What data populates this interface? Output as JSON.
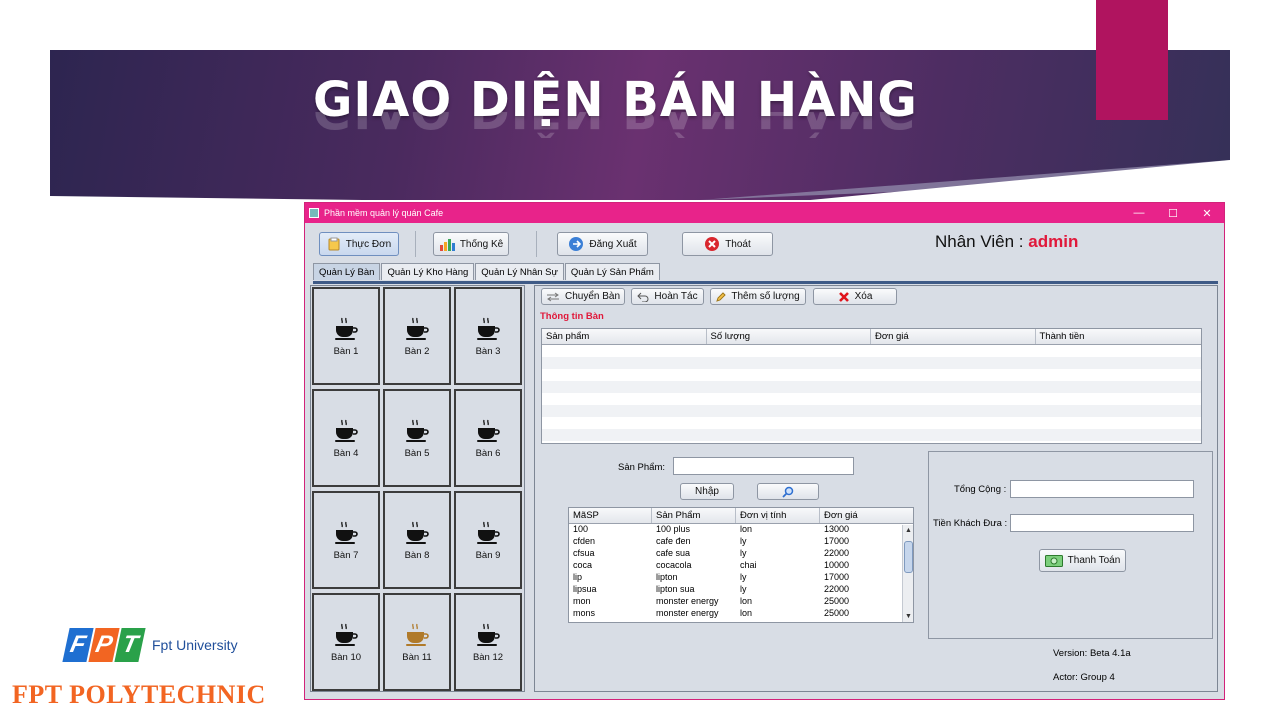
{
  "slide": {
    "title": "GIAO DIỆN BÁN HÀNG",
    "colors": {
      "banner": "#4a2a5e",
      "accent": "#b0145f",
      "poly": "#f26522"
    },
    "logo": {
      "letters": [
        "F",
        "P",
        "T"
      ],
      "letter_colors": [
        "#1f6fd1",
        "#f26522",
        "#2aa14a"
      ],
      "tagline": "Fpt University",
      "brand": "FPT POLYTECHNIC"
    }
  },
  "window": {
    "title": "Phần mềm quản lý quán Cafe",
    "controls": [
      "—",
      "☐",
      "✕"
    ],
    "toolbar": {
      "menu": "Thực Đơn",
      "stats": "Thống Kê",
      "logout": "Đăng Xuất",
      "exit": "Thoát"
    },
    "employee": {
      "label": "Nhân Viên : ",
      "name": "admin"
    },
    "tabs": [
      "Quản Lý Bàn",
      "Quản Lý Kho Hàng",
      "Quản Lý Nhân Sự",
      "Quản Lý Sản Phẩm"
    ],
    "tables": [
      "Bàn 1",
      "Bàn 2",
      "Bàn 3",
      "Bàn 4",
      "Bàn 5",
      "Bàn 6",
      "Bàn 7",
      "Bàn 8",
      "Bàn 9",
      "Bàn 10",
      "Bàn 11",
      "Bàn 12"
    ],
    "table_icon": "coffee-cup-icon",
    "occupied_table": "Bàn 11",
    "actions": {
      "move": "Chuyển Bàn",
      "undo": "Hoàn Tác",
      "add_qty": "Thêm số lượng",
      "delete": "Xóa"
    },
    "info_title": "Thông tin Bàn",
    "order_columns": [
      "Sản phẩm",
      "Số lượng",
      "Đơn giá",
      "Thành tiền"
    ],
    "search": {
      "label": "Sản Phẩm:",
      "value": "",
      "enter": "Nhập"
    },
    "product_columns": [
      "MãSP",
      "Sản Phẩm",
      "Đơn vị tính",
      "Đơn giá"
    ],
    "products": [
      [
        "100",
        "100 plus",
        "lon",
        "13000"
      ],
      [
        "cfden",
        "cafe đen",
        "ly",
        "17000"
      ],
      [
        "cfsua",
        "cafe sua",
        "ly",
        "22000"
      ],
      [
        "coca",
        "cocacola",
        "chai",
        "10000"
      ],
      [
        "lip",
        "lipton",
        "ly",
        "17000"
      ],
      [
        "lipsua",
        "lipton sua",
        "ly",
        "22000"
      ],
      [
        "mon",
        "monster energy",
        "lon",
        "25000"
      ],
      [
        "mons",
        "monster energy",
        "lon",
        "25000"
      ]
    ],
    "payment": {
      "total_label": "Tổng Cộng :",
      "total_value": "",
      "cash_label": "Tiền Khách Đưa :",
      "cash_value": "",
      "pay_button": "Thanh Toán"
    },
    "version": "Version: Beta 4.1a",
    "actor": "Actor: Group 4"
  }
}
